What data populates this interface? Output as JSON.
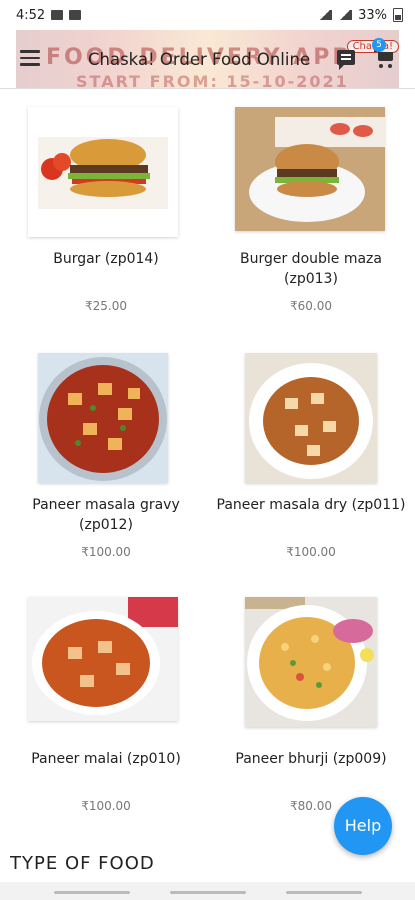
{
  "status_bar": {
    "time": "4:52",
    "battery": "33%"
  },
  "app_bar": {
    "title": "Chaska! Order Food Online",
    "banner_text": "FOOD DELIVERY APP",
    "banner_date": "START FROM: 15-10-2021",
    "banner_tag": "Chaska!",
    "cart_count": "5"
  },
  "products": [
    {
      "name": "Burgar (zp014)",
      "price": "₹25.00",
      "image": "burger"
    },
    {
      "name": "Burger double maza (zp013)",
      "price": "₹60.00",
      "image": "burger-plate"
    },
    {
      "name": "Paneer masala gravy (zp012)",
      "price": "₹100.00",
      "image": "paneer-gravy"
    },
    {
      "name": "Paneer masala dry (zp011)",
      "price": "₹100.00",
      "image": "paneer-dry"
    },
    {
      "name": "Paneer malai (zp010)",
      "price": "₹100.00",
      "image": "paneer-malai"
    },
    {
      "name": "Paneer bhurji (zp009)",
      "price": "₹80.00",
      "image": "paneer-bhurji"
    }
  ],
  "section_title": "TYPE OF FOOD",
  "help_label": "Help",
  "colors": {
    "accent": "#2196f3"
  }
}
